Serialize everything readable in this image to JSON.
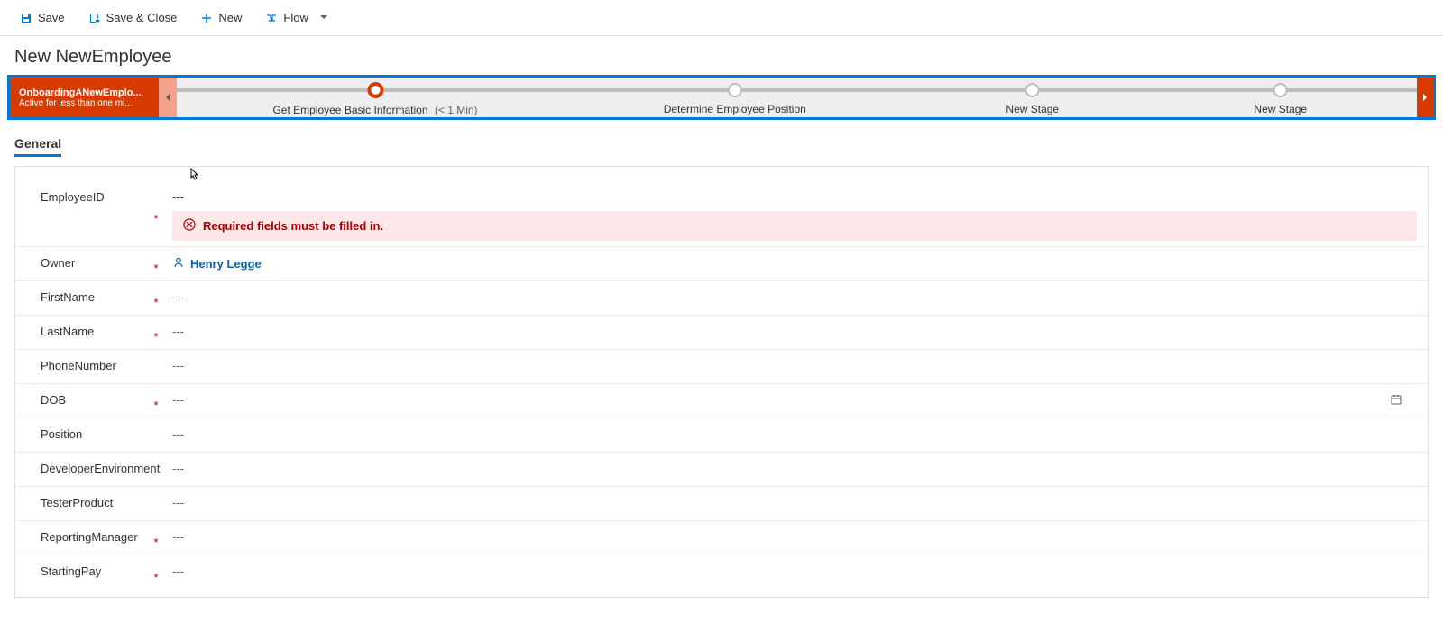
{
  "commands": {
    "save": "Save",
    "save_close": "Save & Close",
    "new": "New",
    "flow": "Flow"
  },
  "header": {
    "title": "New NewEmployee"
  },
  "bpf": {
    "process_name": "OnboardingANewEmplo...",
    "active_time": "Active for less than one mi...",
    "stages": [
      {
        "label": "Get Employee Basic Information",
        "time": "(< 1 Min)",
        "active": true
      },
      {
        "label": "Determine Employee Position",
        "time": "",
        "active": false
      },
      {
        "label": "New Stage",
        "time": "",
        "active": false
      },
      {
        "label": "New Stage",
        "time": "",
        "active": false
      }
    ]
  },
  "tabs": {
    "general": "General"
  },
  "fields": {
    "employee_id": "EmployeeID",
    "owner": "Owner",
    "first_name": "FirstName",
    "last_name": "LastName",
    "phone": "PhoneNumber",
    "dob": "DOB",
    "position": "Position",
    "dev_env": "DeveloperEnvironment",
    "tester_product": "TesterProduct",
    "reporting_mgr": "ReportingManager",
    "starting_pay": "StartingPay"
  },
  "values": {
    "owner_name": "Henry Legge",
    "empty": "---"
  },
  "messages": {
    "required_error": "Required fields must be filled in."
  }
}
